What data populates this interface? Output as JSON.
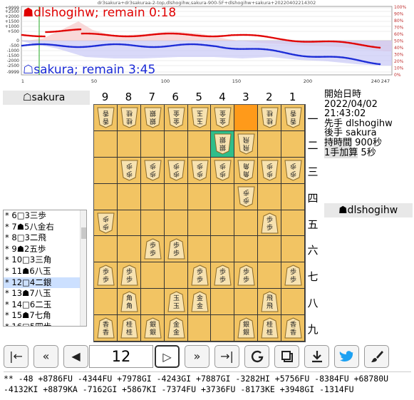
{
  "graph": {
    "caption": "dr3sakura+dr3sakuraa-2-top,dlshogihw,sakura-900-5F+dlshogihw+sakura+20220402214302",
    "sente_label": "☗dlshogihw; remain 0:18",
    "gote_label": "☖sakura; remain 3:45",
    "left_ticks": [
      "+9999",
      "+2500",
      "+2000",
      "+1500",
      "+1000",
      "+500",
      "0",
      "-500",
      "-1000",
      "-1500",
      "-2000",
      "-2500",
      "-9999"
    ],
    "right_ticks": [
      "100%",
      "90%",
      "80%",
      "70%",
      "60%",
      "50%",
      "40%",
      "30%",
      "20%",
      "10%",
      "0%"
    ],
    "x_ticks": [
      "1",
      "50",
      "100",
      "150",
      "200",
      "240",
      "247"
    ],
    "colors": {
      "sente": "#e00000",
      "gote": "#1a2ad6",
      "cursor": "#22aa22"
    }
  },
  "gote": {
    "name": "☖sakura"
  },
  "sente": {
    "name": "☗dlshogihw"
  },
  "moves": [
    "* 6□3三歩",
    "* 7☗5八金右",
    "* 8□3二飛",
    "* 9☗2五歩",
    "* 10□3三角",
    "* 11☗6八玉",
    "* 12□4二銀",
    "* 13☗7八玉",
    "* 14□6二玉",
    "* 15☗7七角",
    "* 16□5四歩"
  ],
  "selected_move": 6,
  "board": {
    "files": [
      "9",
      "8",
      "7",
      "6",
      "5",
      "4",
      "3",
      "2",
      "1"
    ],
    "ranks": [
      "一",
      "二",
      "三",
      "四",
      "五",
      "六",
      "七",
      "八",
      "九"
    ]
  },
  "info": {
    "start_label": "開始日時",
    "start_value": "2022/04/02 21:43:02",
    "first_label": "先手",
    "first_value": "dlshogihw",
    "second_label": "後手",
    "second_value": "sakura",
    "time_label": "持時間",
    "time_value": "900秒",
    "inc_label": "1手加算",
    "inc_value": "5秒"
  },
  "controls": {
    "move_number": "12",
    "first": "|←",
    "prev10": "«",
    "prev": "◀",
    "next": "▷",
    "next10": "»",
    "last": "→|"
  },
  "kifu": {
    "line1": "** -48 +8786FU -4344FU +7978GI -4243GI +7887GI -3282HI +5756FU -8384FU +68780U",
    "line2": "-4132KI +8879KA -7162GI +5867KI -7374FU +3736FU -8173KE +3948GI -1314FU"
  }
}
